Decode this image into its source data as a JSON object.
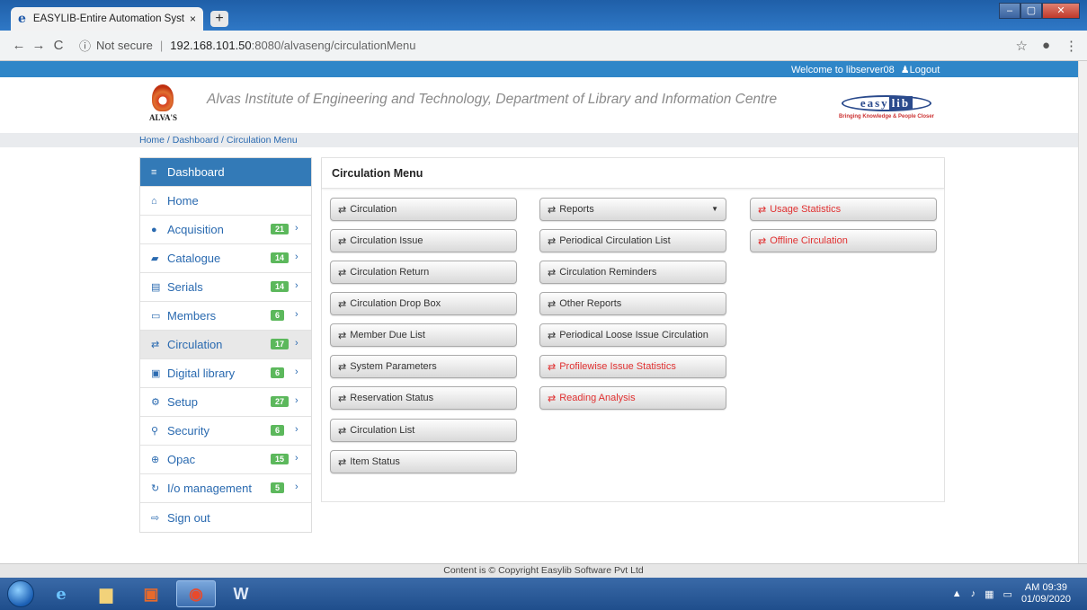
{
  "browser": {
    "tab_title": "EASYLIB-Entire Automation Syste",
    "tab_close": "×",
    "new_tab": "+",
    "security": "Not secure",
    "url_host": "192.168.101.50",
    "url_path": ":8080/alvaseng/circulationMenu",
    "back": "←",
    "forward": "→",
    "reload": "C",
    "info": "ⓘ",
    "star": "☆",
    "menu": "⋮"
  },
  "topbar": {
    "welcome": "Welcome to libserver08",
    "logout": "Logout"
  },
  "header": {
    "org_logo_text": "ALVA'S",
    "institute_title": "Alvas Institute of Engineering and Technology, Department of Library and Information Centre",
    "brand_name_a": "easy",
    "brand_name_b": "lib",
    "brand_tagline": "Bringing Knowledge & People Closer"
  },
  "breadcrumb": "Home / Dashboard / Circulation Menu",
  "sidebar": {
    "items": [
      {
        "label": "Dashboard",
        "icon": "≡",
        "badge": ""
      },
      {
        "label": "Home",
        "icon": "⌂",
        "badge": ""
      },
      {
        "label": "Acquisition",
        "icon": "●",
        "badge": "21"
      },
      {
        "label": "Catalogue",
        "icon": "▰",
        "badge": "14"
      },
      {
        "label": "Serials",
        "icon": "▤",
        "badge": "14"
      },
      {
        "label": "Members",
        "icon": "▭",
        "badge": "6"
      },
      {
        "label": "Circulation",
        "icon": "⇄",
        "badge": "17"
      },
      {
        "label": "Digital library",
        "icon": "▣",
        "badge": "6"
      },
      {
        "label": "Setup",
        "icon": "⚙",
        "badge": "27"
      },
      {
        "label": "Security",
        "icon": "⚲",
        "badge": "6"
      },
      {
        "label": "Opac",
        "icon": "⊕",
        "badge": "15"
      },
      {
        "label": "I/o management",
        "icon": "↻",
        "badge": "5"
      },
      {
        "label": "Sign out",
        "icon": "⇨",
        "badge": ""
      }
    ],
    "chevron": "›"
  },
  "panel": {
    "title": "Circulation Menu",
    "col1": [
      "Circulation",
      "Circulation Issue",
      "Circulation Return",
      "Circulation Drop Box",
      "Member Due List",
      "System Parameters",
      "Reservation Status",
      "Circulation List",
      "Item Status"
    ],
    "col2": [
      "Reports",
      "Periodical Circulation List",
      "Circulation Reminders",
      "Other Reports",
      "Periodical Loose Issue Circulation",
      "Profilewise Issue Statistics",
      "Reading Analysis"
    ],
    "col3": [
      "Usage Statistics",
      "Offline Circulation"
    ],
    "icon": "⇄",
    "red_color": "#e03030"
  },
  "footer": "Content is © Copyright Easylib Software Pvt Ltd",
  "taskbar": {
    "time": "AM 09:39",
    "date": "01/09/2020"
  }
}
